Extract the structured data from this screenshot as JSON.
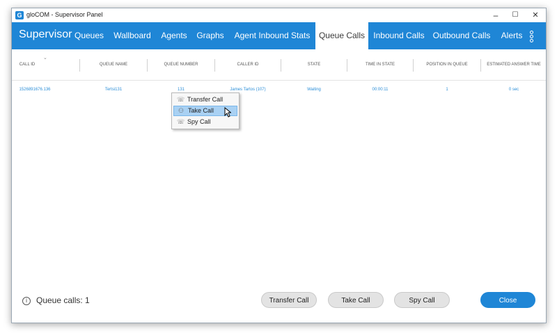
{
  "window": {
    "title": "gloCOM - Supervisor Panel",
    "app_icon": "G",
    "minimize": "–",
    "maximize": "☐",
    "close": "✕"
  },
  "nav": {
    "brand": "Supervisor",
    "items": [
      "Queues",
      "Wallboard",
      "Agents",
      "Graphs",
      "Agent Inbound Stats",
      "Queue Calls",
      "Inbound Calls",
      "Outbound Calls",
      "Alerts"
    ],
    "active": "Queue Calls",
    "accent": "#1f86d6"
  },
  "table": {
    "columns": [
      "Call ID",
      "Queue Name",
      "Queue Number",
      "Caller ID",
      "State",
      "Time in State",
      "Position in Queue",
      "Estimated Answer Time"
    ],
    "rows": [
      [
        "1526891676.136",
        "Tertsi131",
        "131",
        "James Tartos (107)",
        "Waiting",
        "00:00:11",
        "1",
        "0 sec"
      ]
    ]
  },
  "context_menu": {
    "items": [
      {
        "label": "Transfer Call",
        "icon": "transfer-call-icon"
      },
      {
        "label": "Take Call",
        "icon": "take-call-icon"
      },
      {
        "label": "Spy Call",
        "icon": "spy-call-icon"
      }
    ],
    "hovered": "Take Call"
  },
  "footer": {
    "info_text": "Queue calls: 1",
    "transfer_button": "Transfer Call",
    "take_button": "Take Call",
    "spy_button": "Spy Call",
    "close_button": "Close"
  }
}
